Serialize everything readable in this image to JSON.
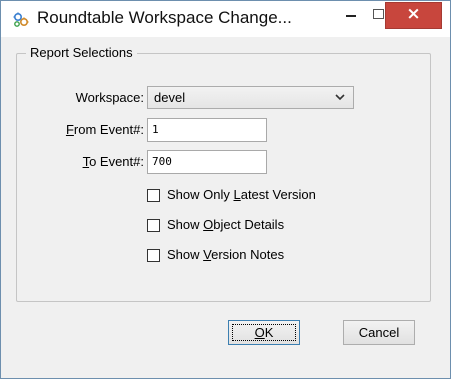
{
  "window": {
    "title": "Roundtable Workspace Change...",
    "icon": "gear-cluster-icon",
    "controls": {
      "minimize": "–",
      "maximize": "□",
      "close": "×"
    }
  },
  "group": {
    "label": "Report Selections"
  },
  "form": {
    "workspace": {
      "label_prefix": "",
      "label_accel": "",
      "label_rest": "Workspace:",
      "value": "devel"
    },
    "from_event": {
      "label_accel": "F",
      "label_rest": "rom Event#:",
      "value": "1"
    },
    "to_event": {
      "label_accel": "T",
      "label_rest": "o Event#:",
      "value": "700"
    }
  },
  "options": [
    {
      "pre": "Show Only ",
      "accel": "L",
      "post": "atest Version",
      "checked": false
    },
    {
      "pre": "Show ",
      "accel": "O",
      "post": "bject Details",
      "checked": false
    },
    {
      "pre": "Show ",
      "accel": "V",
      "post": "ersion Notes",
      "checked": false
    }
  ],
  "buttons": {
    "ok": {
      "accel": "O",
      "rest": "K"
    },
    "cancel": {
      "label": "Cancel"
    }
  },
  "colors": {
    "close_bg": "#c8463d",
    "window_border": "#6d8fae",
    "dialog_bg": "#f0f0f0"
  }
}
